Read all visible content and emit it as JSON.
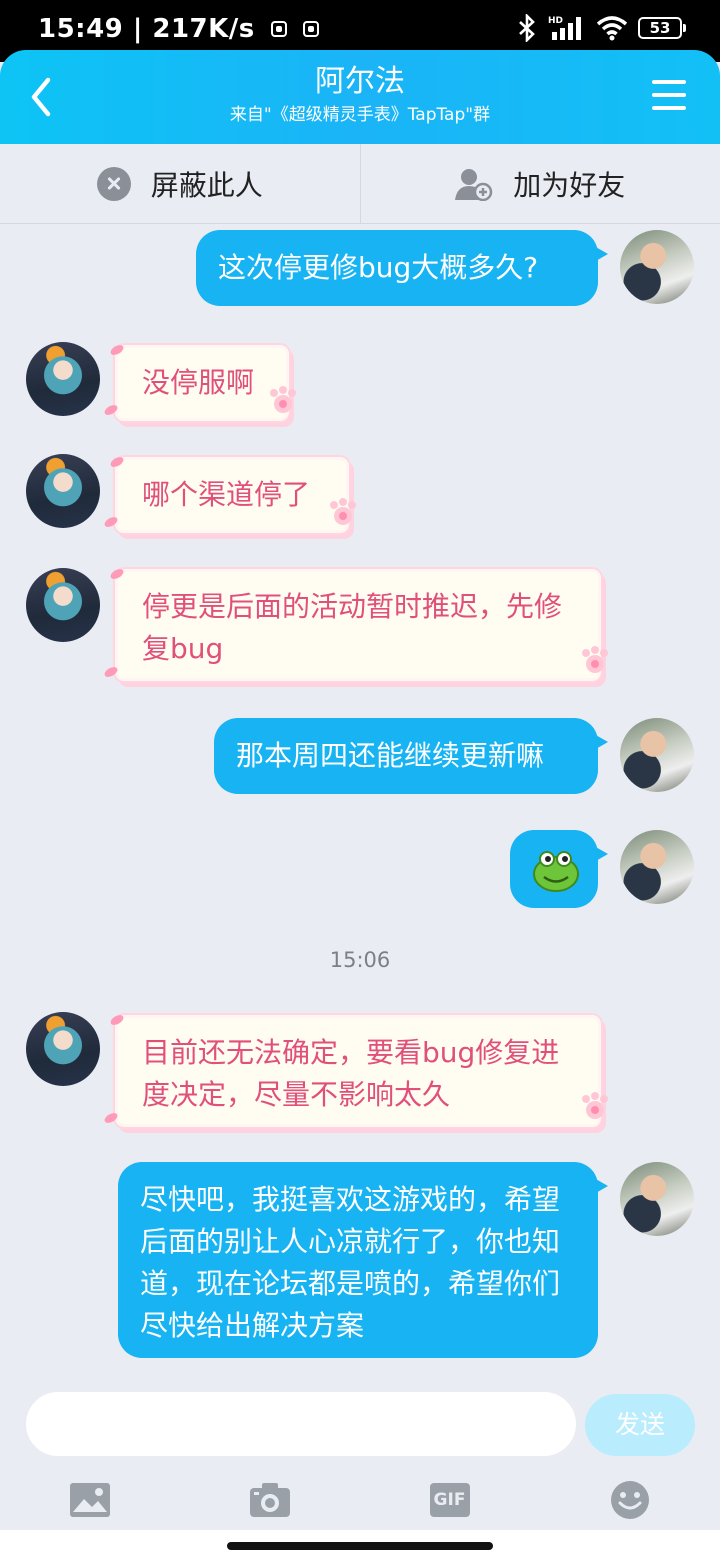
{
  "status_bar": {
    "time": "15:49",
    "speed": "217K/s",
    "battery": "53",
    "icons": [
      "app-icon",
      "app-icon",
      "bluetooth-icon",
      "hd-signal-icon",
      "wifi-icon",
      "battery-icon"
    ]
  },
  "header": {
    "title": "阿尔法",
    "subtitle": "来自\"《超级精灵手表》TapTap\"群",
    "back_icon": "chevron-left-icon",
    "menu_icon": "menu-icon"
  },
  "actions": {
    "block_label": "屏蔽此人",
    "add_friend_label": "加为好友"
  },
  "messages": [
    {
      "sender": "me",
      "type": "text",
      "text": "这次停更修bug大概多久?"
    },
    {
      "sender": "other",
      "type": "text",
      "text": "没停服啊"
    },
    {
      "sender": "other",
      "type": "text",
      "text": "哪个渠道停了"
    },
    {
      "sender": "other",
      "type": "text",
      "text": "停更是后面的活动暂时推迟，先修复bug"
    },
    {
      "sender": "me",
      "type": "text",
      "text": "那本周四还能继续更新嘛"
    },
    {
      "sender": "me",
      "type": "sticker",
      "icon": "frog-emoji-icon"
    },
    {
      "sender": "other",
      "type": "text",
      "text": "目前还无法确定，要看bug修复进度决定，尽量不影响太久"
    },
    {
      "sender": "me",
      "type": "text",
      "text": "尽快吧，我挺喜欢这游戏的，希望后面的别让人心凉就行了，你也知道，现在论坛都是喷的，希望你们尽快给出解决方案"
    }
  ],
  "timestamp": "15:06",
  "input": {
    "value": "",
    "placeholder": "",
    "send_label": "发送"
  },
  "toolbar": {
    "items": [
      "image-icon",
      "camera-icon",
      "gif-icon",
      "emoji-icon"
    ],
    "gif_label": "GIF"
  },
  "colors": {
    "accent": "#17b3f2",
    "header_gradient_start": "#0dc4f5",
    "pink_text": "#e0507a",
    "background": "#e9edf3"
  }
}
